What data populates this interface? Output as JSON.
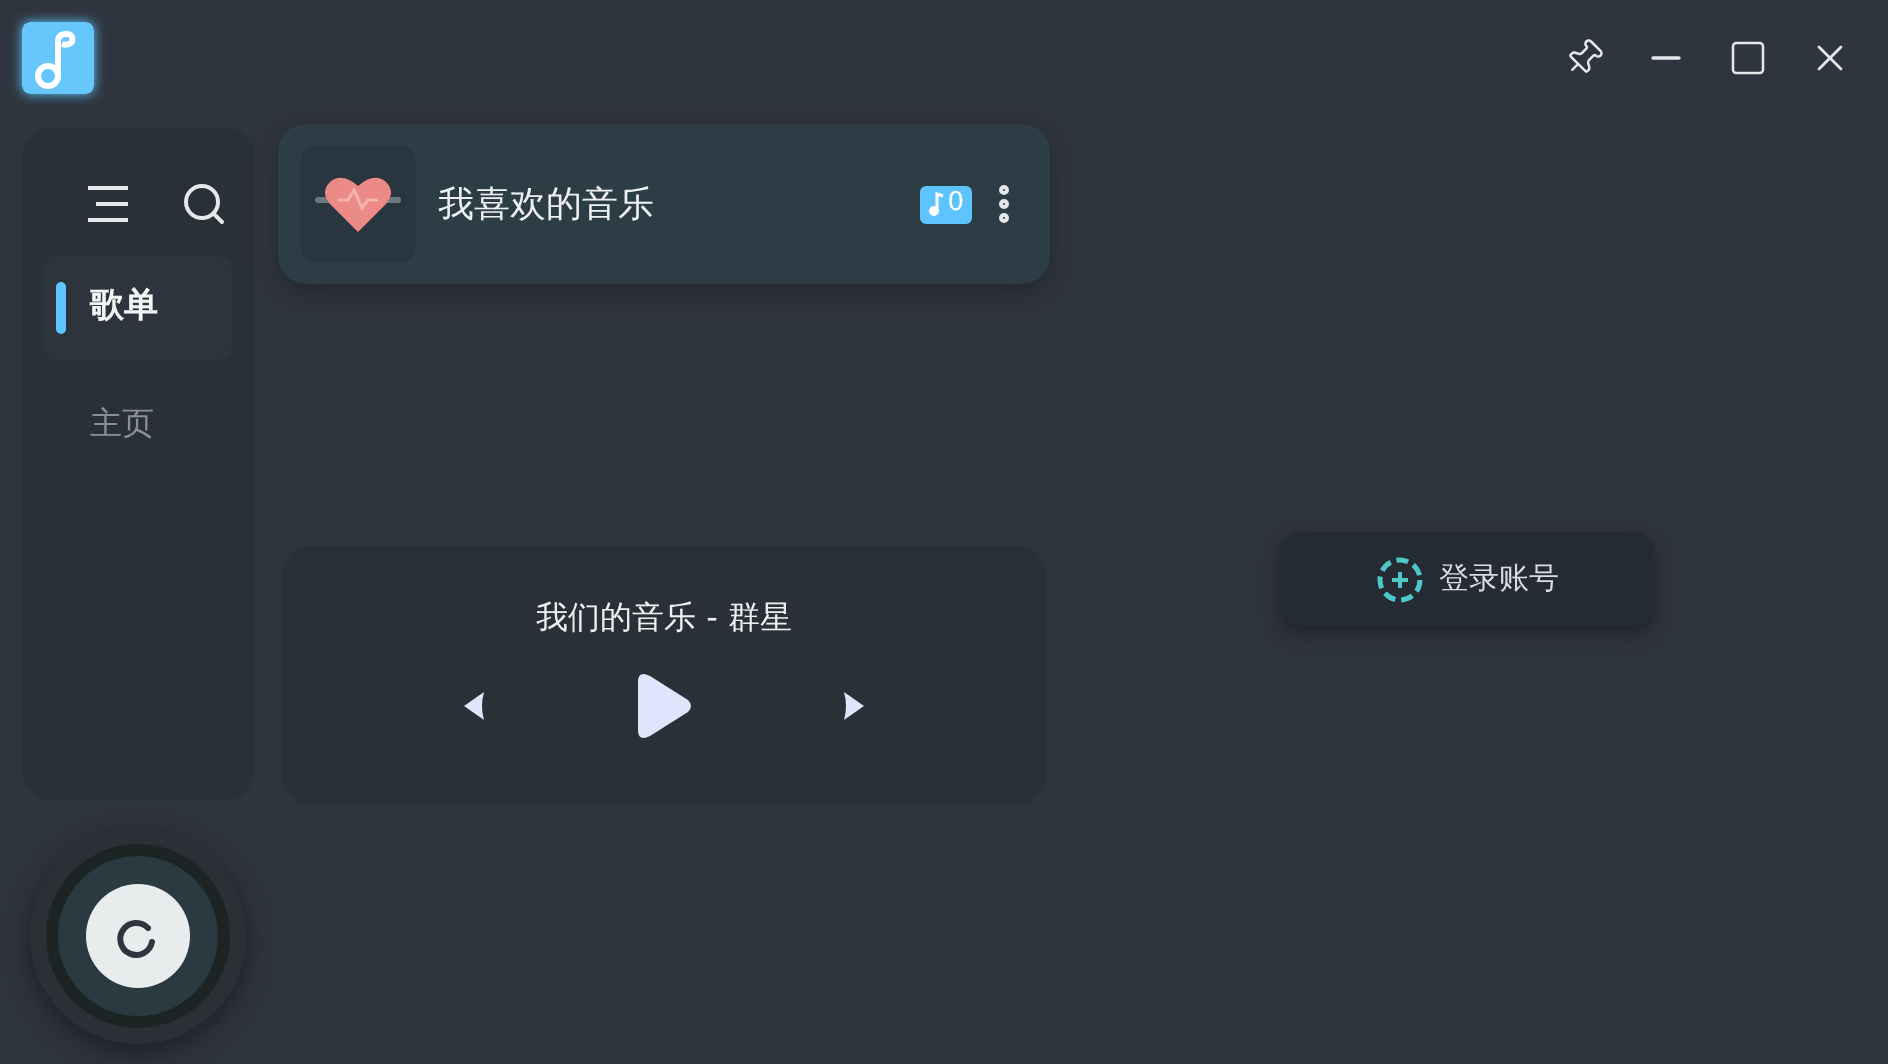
{
  "sidebar": {
    "items": [
      {
        "label": "歌单",
        "selected": true
      },
      {
        "label": "主页",
        "selected": false
      }
    ]
  },
  "playlist": {
    "title": "我喜欢的音乐",
    "count": "0"
  },
  "player": {
    "track": "我们的音乐 - 群星",
    "playing": false
  },
  "login_button": {
    "label": "登录账号"
  }
}
